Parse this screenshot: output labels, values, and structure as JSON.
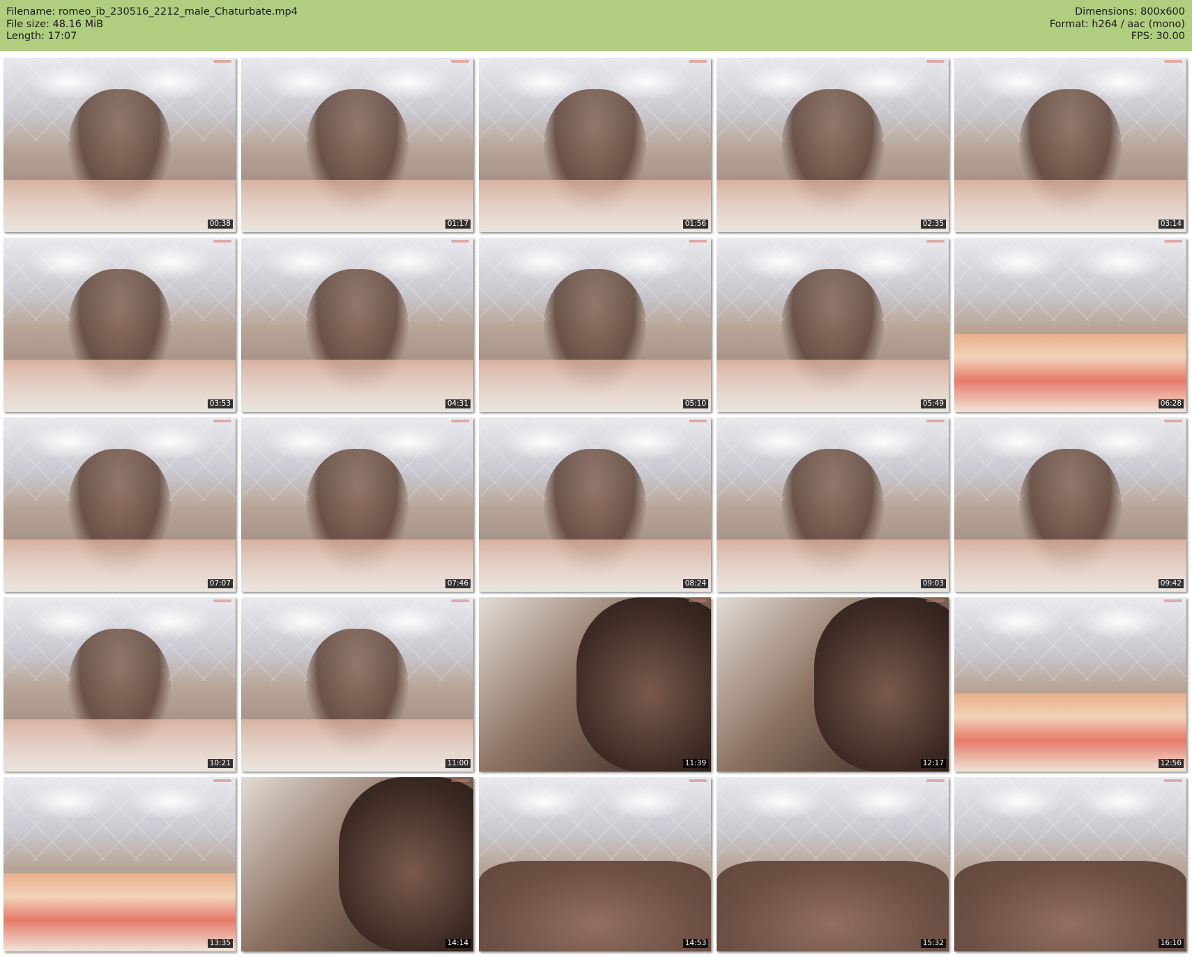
{
  "header": {
    "filename": "Filename: romeo_ib_230516_2212_male_Chaturbate.mp4",
    "filesize": "File size: 48.16 MiB",
    "length": "Length: 17:07",
    "dimensions": "Dimensions: 800x600",
    "format": "Format: h264 / aac (mono)",
    "fps": "FPS: 30.00"
  },
  "thumbnails": [
    {
      "time": "00:38",
      "scene": "reclining"
    },
    {
      "time": "01:17",
      "scene": "reclining-phone"
    },
    {
      "time": "01:56",
      "scene": "reclining-phone"
    },
    {
      "time": "02:35",
      "scene": "reclining-phone"
    },
    {
      "time": "03:14",
      "scene": "reclining-phone"
    },
    {
      "time": "03:53",
      "scene": "reclining"
    },
    {
      "time": "04:31",
      "scene": "reclining"
    },
    {
      "time": "05:10",
      "scene": "reclining"
    },
    {
      "time": "05:49",
      "scene": "reclining"
    },
    {
      "time": "06:28",
      "scene": "empty-bed"
    },
    {
      "time": "07:07",
      "scene": "reclining"
    },
    {
      "time": "07:46",
      "scene": "reclining"
    },
    {
      "time": "08:24",
      "scene": "reclining"
    },
    {
      "time": "09:03",
      "scene": "reclining"
    },
    {
      "time": "09:42",
      "scene": "reclining"
    },
    {
      "time": "10:21",
      "scene": "reclining"
    },
    {
      "time": "11:00",
      "scene": "reclining"
    },
    {
      "time": "11:39",
      "scene": "close-up"
    },
    {
      "time": "12:17",
      "scene": "close-up"
    },
    {
      "time": "12:56",
      "scene": "empty-bed"
    },
    {
      "time": "13:35",
      "scene": "empty-bed"
    },
    {
      "time": "14:14",
      "scene": "close-up"
    },
    {
      "time": "14:53",
      "scene": "back"
    },
    {
      "time": "15:32",
      "scene": "back"
    },
    {
      "time": "16:10",
      "scene": "back"
    }
  ]
}
